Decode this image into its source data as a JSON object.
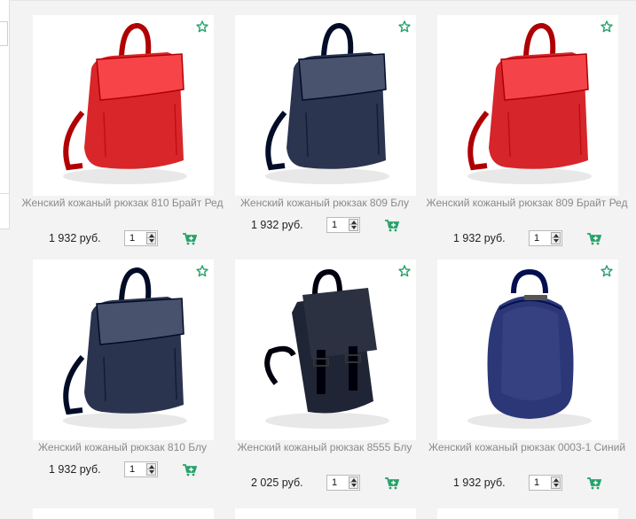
{
  "products": [
    {
      "title": "Женский кожаный рюкзак 810 Брайт Ред",
      "price": "1 932 руб.",
      "qty": "1",
      "color": "#d9262a",
      "style": "flap"
    },
    {
      "title": "Женский кожаный рюкзак 809 Блу",
      "price": "1 932 руб.",
      "qty": "1",
      "color": "#2b3550",
      "style": "flap"
    },
    {
      "title": "Женский кожаный рюкзак 809 Брайт Ред",
      "price": "1 932 руб.",
      "qty": "1",
      "color": "#d6262b",
      "style": "flap"
    },
    {
      "title": "Женский кожаный рюкзак 810 Блу",
      "price": "1 932 руб.",
      "qty": "1",
      "color": "#2a344f",
      "style": "flap"
    },
    {
      "title": "Женский кожаный рюкзак 8555 Блу",
      "price": "2 025 руб.",
      "qty": "1",
      "color": "#1f2535",
      "style": "buckle"
    },
    {
      "title": "Женский кожаный рюкзак 0003-1 Синий",
      "price": "1 932 руб.",
      "qty": "1",
      "color": "#2c3778",
      "style": "rounded"
    }
  ],
  "icons": {
    "favorite": "star-outline-icon",
    "cart": "add-to-cart-icon"
  },
  "colors": {
    "accent": "#27a26a",
    "title": "#8a8a8a"
  }
}
